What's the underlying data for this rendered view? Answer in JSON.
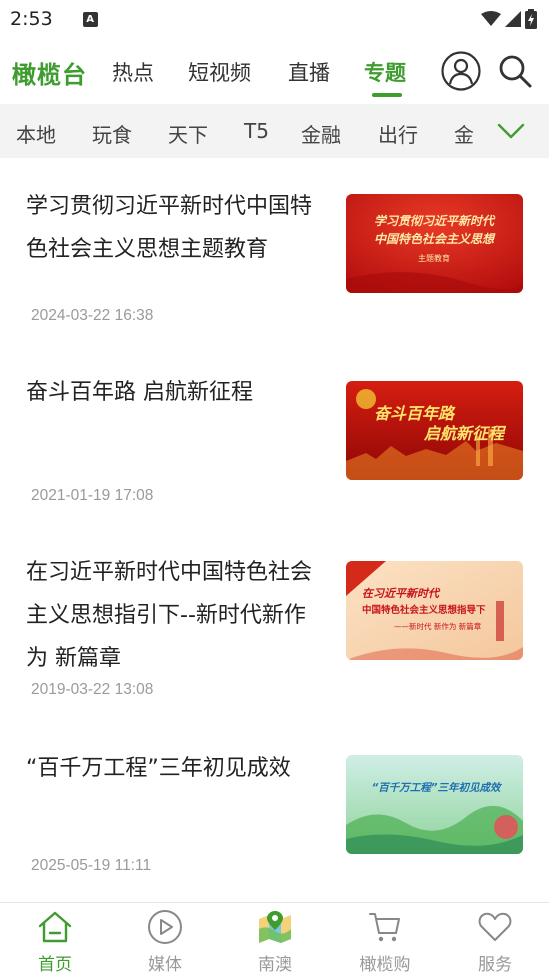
{
  "status": {
    "time": "2:53",
    "notif_letter": "A"
  },
  "top_nav": {
    "brand": "橄榄台",
    "tabs": [
      "热点",
      "短视频",
      "直播",
      "专题"
    ],
    "active_tab": "专题",
    "accent": "#3f9c2f"
  },
  "categories": [
    "本地",
    "玩食",
    "天下",
    "T5",
    "金融",
    "出行",
    "金"
  ],
  "feed": [
    {
      "title": "学习贯彻习近平新时代中国特色社会主义思想主题教育",
      "date": "2024-03-22 16:38",
      "thumb_text": [
        "学习贯彻习近平新时代",
        "中国特色社会主义思想",
        "主题教育"
      ]
    },
    {
      "title": "奋斗百年路 启航新征程",
      "date": "2021-01-19 17:08",
      "thumb_text": [
        "奋斗百年路",
        "启航新征程"
      ]
    },
    {
      "title": "在习近平新时代中国特色社会主义思想指引下--新时代新作为 新篇章",
      "date": "2019-03-22 13:08",
      "thumb_text": [
        "在习近平新时代",
        "中国特色社会主义思想指导下",
        "——新时代 新作为 新篇章"
      ]
    },
    {
      "title": "“百千万工程”三年初见成效",
      "date": "2025-05-19 11:11",
      "thumb_text": [
        "“百千万工程”三年初见成效"
      ]
    }
  ],
  "bottom_nav": [
    {
      "label": "首页",
      "icon": "home-icon",
      "active": true
    },
    {
      "label": "媒体",
      "icon": "play-icon",
      "active": false
    },
    {
      "label": "南澳",
      "icon": "map-icon",
      "active": false
    },
    {
      "label": "橄榄购",
      "icon": "cart-icon",
      "active": false
    },
    {
      "label": "服务",
      "icon": "heart-icon",
      "active": false
    }
  ]
}
